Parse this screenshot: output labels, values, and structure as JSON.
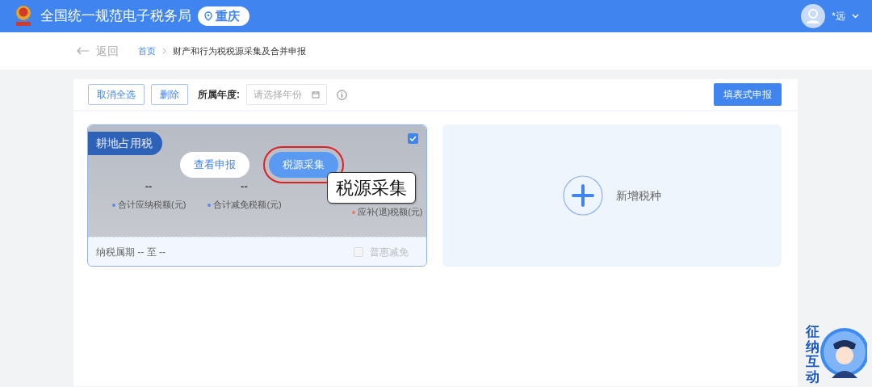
{
  "header": {
    "title": "全国统一规范电子税务局",
    "region": "重庆",
    "user": "*远"
  },
  "back": "返回",
  "breadcrumb": [
    {
      "label": "首页",
      "link": true
    },
    {
      "label": "财产和行为税税源采集及合并申报",
      "link": false
    }
  ],
  "toolbar": {
    "buttons": [
      "取消全选",
      "删除"
    ],
    "year_label": "所属年度:",
    "year_placeholder": "请选择年份",
    "submit": "填表式申报"
  },
  "cards": [
    {
      "tax": "耕地占用税",
      "checked": true,
      "hover": true,
      "actions": [
        {
          "label": "查看申报",
          "primary": false,
          "highlighted": false
        },
        {
          "label": "税源采集",
          "primary": true,
          "highlighted": true
        }
      ],
      "stats": [
        {
          "value": "--",
          "label": "合计应纳税额(元)",
          "color": "#5b8def"
        },
        {
          "value": "--",
          "label": "合计减免税额(元)",
          "color": "#5b8def"
        },
        {
          "label": "应补(退)税额(元)",
          "color": "#f07c5c"
        }
      ],
      "period": "纳税属期 -- 至 --",
      "relief": {
        "label": "普惠减免",
        "checked": false,
        "disabled": true
      }
    }
  ],
  "add_card": {
    "label": "新增税种"
  },
  "callout": "税源采集",
  "assistant": "征纳互动"
}
